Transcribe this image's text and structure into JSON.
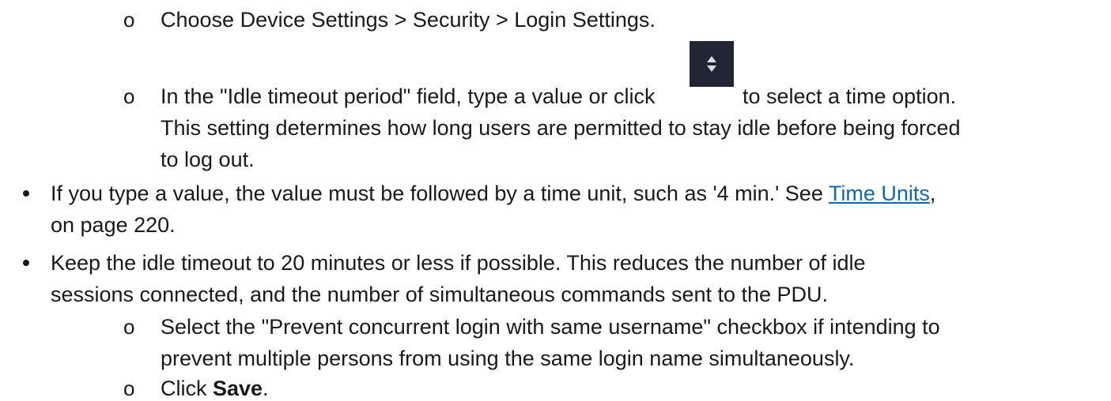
{
  "steps_top": [
    {
      "marker": "o",
      "text": "Choose Device Settings > Security > Login Settings."
    },
    {
      "marker": "o",
      "line1_before_icon": "In the \"Idle timeout period\" field, type a value or click",
      "line1_after_icon": "to select a time option.",
      "line2": "This setting determines how long users are permitted to stay idle before being forced",
      "line3": "to log out.",
      "icon": "up-down-stepper-icon"
    }
  ],
  "notes": [
    {
      "marker": "•",
      "line1_before_link": "If you type a value, the value must be followed by a time unit, such as '4 min.' See",
      "link_text": "Time Units",
      "line1_after_link": ",",
      "line2": "on page 220."
    },
    {
      "marker": "•",
      "line1": "Keep the idle timeout to 20 minutes or less if possible. This reduces the number of idle",
      "line2": "sessions connected, and the number of simultaneous commands sent to the PDU."
    }
  ],
  "steps_bottom": [
    {
      "marker": "o",
      "line1": "Select the \"Prevent concurrent login with same username\" checkbox if intending to",
      "line2": "prevent multiple persons from using the same login name simultaneously."
    },
    {
      "marker": "o",
      "before_bold": "Click",
      "bold": "Save",
      "after_bold": "."
    }
  ],
  "colors": {
    "text": "#1a1a1a",
    "link": "#1565a8",
    "stepper_bg": "#202633",
    "stepper_arrow": "#d8dce3"
  }
}
